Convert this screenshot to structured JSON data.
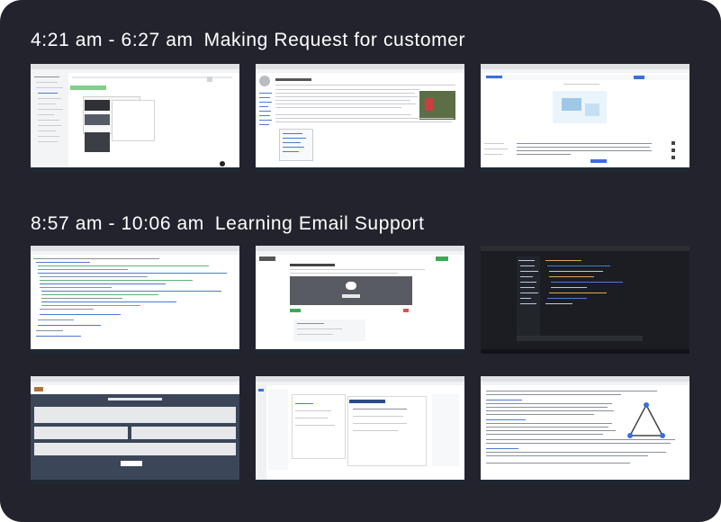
{
  "sections": [
    {
      "time": "4:21 am - 6:27 am",
      "label": "Making Request for customer",
      "screenshots": [
        {
          "name": "code-editor-with-dialog"
        },
        {
          "name": "wikipedia-marketing-article"
        },
        {
          "name": "helpdesk-ticket-page"
        }
      ]
    },
    {
      "time": "8:57 am - 10:06 am",
      "label": "Learning Email Support",
      "screenshots": [
        {
          "name": "html-source-view"
        },
        {
          "name": "convert-image-to-text-tool"
        },
        {
          "name": "dark-theme-code-editor"
        },
        {
          "name": "announcement-page"
        },
        {
          "name": "admin-dashboard-panels"
        },
        {
          "name": "document-with-diagram"
        }
      ]
    }
  ],
  "colors": {
    "panel_background": "#23232e",
    "title_text": "#ffffff"
  }
}
